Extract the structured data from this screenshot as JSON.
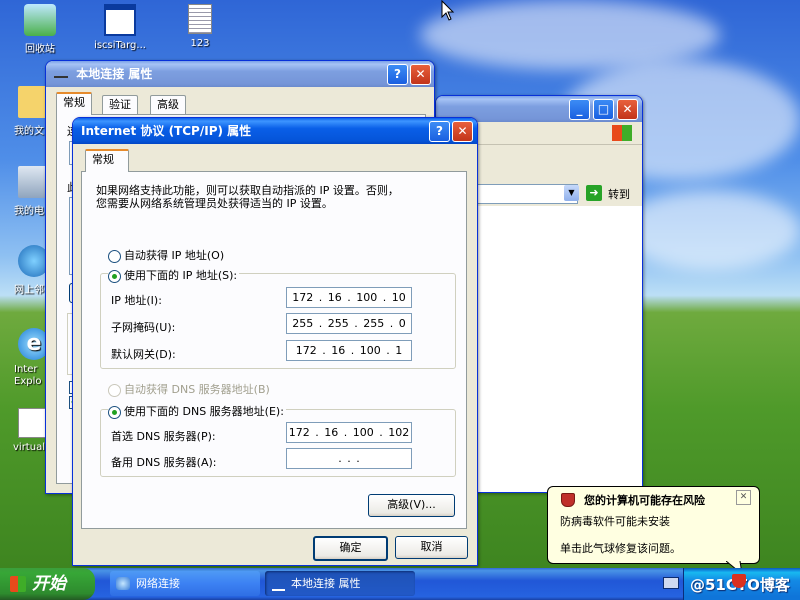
{
  "desktop": {
    "icons": [
      {
        "label": "回收站"
      },
      {
        "label": "iscsiTarg..."
      },
      {
        "label": "123"
      },
      {
        "label": "我的文"
      },
      {
        "label": "我的电"
      },
      {
        "label": "网上邻"
      },
      {
        "label": "Inter Explo"
      },
      {
        "label": "virtual"
      }
    ]
  },
  "local_conn_window": {
    "title": "本地连接 属性",
    "help_btn": "?",
    "close_btn": "✕",
    "tabs": [
      "常规",
      "验证",
      "高级"
    ],
    "partial_labels": [
      "连",
      "此"
    ]
  },
  "network_window": {
    "min_btn": "_",
    "max_btn": "□",
    "close_btn": "✕",
    "go_label": "转到"
  },
  "tcpip_dialog": {
    "title": "Internet 协议 (TCP/IP) 属性",
    "help_btn": "?",
    "close_btn": "✕",
    "tab": "常规",
    "description_line1": "如果网络支持此功能，则可以获取自动指派的 IP 设置。否则，",
    "description_line2": "您需要从网络系统管理员处获得适当的 IP 设置。",
    "auto_ip_label": "自动获得 IP 地址(O)",
    "manual_ip_label": "使用下面的 IP 地址(S):",
    "ip_label": "IP 地址(I):",
    "ip_value": "172 . 16 . 100 . 10",
    "mask_label": "子网掩码(U):",
    "mask_value": "255 . 255 . 255 . 0",
    "gateway_label": "默认网关(D):",
    "gateway_value": "172 . 16 . 100 . 1",
    "auto_dns_label": "自动获得 DNS 服务器地址(B)",
    "manual_dns_label": "使用下面的 DNS 服务器地址(E):",
    "pref_dns_label": "首选 DNS 服务器(P):",
    "pref_dns_value": "172 . 16 . 100 . 102",
    "alt_dns_label": "备用 DNS 服务器(A):",
    "alt_dns_value": ".     .     .",
    "advanced_btn": "高级(V)...",
    "ok_btn": "确定",
    "cancel_btn": "取消"
  },
  "taskbar": {
    "start_label": "开始",
    "items": [
      "网络连接",
      "本地连接 属性"
    ],
    "watermark": "@51CTO博客"
  },
  "balloon": {
    "title": "您的计算机可能存在风险",
    "line1": "防病毒软件可能未安装",
    "line2": "单击此气球修复该问题。",
    "close": "✕"
  }
}
